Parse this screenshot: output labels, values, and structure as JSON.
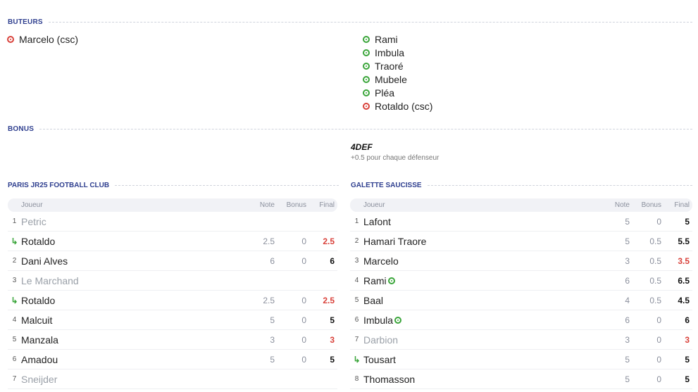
{
  "buteurs": {
    "label": "BUTEURS",
    "home": [
      {
        "name": "Marcelo (csc)",
        "type": "red"
      }
    ],
    "away": [
      {
        "name": "Rami",
        "type": "green"
      },
      {
        "name": "Imbula",
        "type": "green"
      },
      {
        "name": "Traoré",
        "type": "green"
      },
      {
        "name": "Mubele",
        "type": "green"
      },
      {
        "name": "Pléa",
        "type": "green"
      },
      {
        "name": "Rotaldo (csc)",
        "type": "red"
      }
    ]
  },
  "bonus": {
    "label": "BONUS",
    "away_name": "4DEF",
    "away_desc": "+0.5 pour chaque défenseur"
  },
  "columns": {
    "player": "Joueur",
    "note": "Note",
    "bonus": "Bonus",
    "final": "Final"
  },
  "home_team": {
    "name": "PARIS JR25 FOOTBALL CLUB",
    "rows": [
      {
        "num": "1",
        "name": "Petric",
        "note": "",
        "bonus": "",
        "final": "",
        "subbed": true,
        "low": false
      },
      {
        "num": "↳",
        "name": "Rotaldo",
        "note": "2.5",
        "bonus": "0",
        "final": "2.5",
        "sub": true,
        "low": true
      },
      {
        "num": "2",
        "name": "Dani Alves",
        "note": "6",
        "bonus": "0",
        "final": "6",
        "low": false
      },
      {
        "num": "3",
        "name": "Le Marchand",
        "note": "",
        "bonus": "",
        "final": "",
        "subbed": true,
        "low": false
      },
      {
        "num": "↳",
        "name": "Rotaldo",
        "note": "2.5",
        "bonus": "0",
        "final": "2.5",
        "sub": true,
        "low": true
      },
      {
        "num": "4",
        "name": "Malcuit",
        "note": "5",
        "bonus": "0",
        "final": "5",
        "low": false
      },
      {
        "num": "5",
        "name": "Manzala",
        "note": "3",
        "bonus": "0",
        "final": "3",
        "low": true
      },
      {
        "num": "6",
        "name": "Amadou",
        "note": "5",
        "bonus": "0",
        "final": "5",
        "low": false
      },
      {
        "num": "7",
        "name": "Sneijder",
        "note": "",
        "bonus": "",
        "final": "",
        "subbed": true,
        "low": false
      }
    ]
  },
  "away_team": {
    "name": "GALETTE SAUCISSE",
    "rows": [
      {
        "num": "1",
        "name": "Lafont",
        "note": "5",
        "bonus": "0",
        "final": "5",
        "low": false
      },
      {
        "num": "2",
        "name": "Hamari Traore",
        "note": "5",
        "bonus": "0.5",
        "final": "5.5",
        "low": false
      },
      {
        "num": "3",
        "name": "Marcelo",
        "note": "3",
        "bonus": "0.5",
        "final": "3.5",
        "low": true
      },
      {
        "num": "4",
        "name": "Rami",
        "note": "6",
        "bonus": "0.5",
        "final": "6.5",
        "low": false,
        "goal": true
      },
      {
        "num": "5",
        "name": "Baal",
        "note": "4",
        "bonus": "0.5",
        "final": "4.5",
        "low": false
      },
      {
        "num": "6",
        "name": "Imbula",
        "note": "6",
        "bonus": "0",
        "final": "6",
        "low": false,
        "goal": true
      },
      {
        "num": "7",
        "name": "Darbion",
        "note": "3",
        "bonus": "0",
        "final": "3",
        "low": true,
        "subbed": true
      },
      {
        "num": "↳",
        "name": "Tousart",
        "note": "5",
        "bonus": "0",
        "final": "5",
        "low": false,
        "sub": true
      },
      {
        "num": "8",
        "name": "Thomasson",
        "note": "5",
        "bonus": "0",
        "final": "5",
        "low": false
      }
    ]
  }
}
